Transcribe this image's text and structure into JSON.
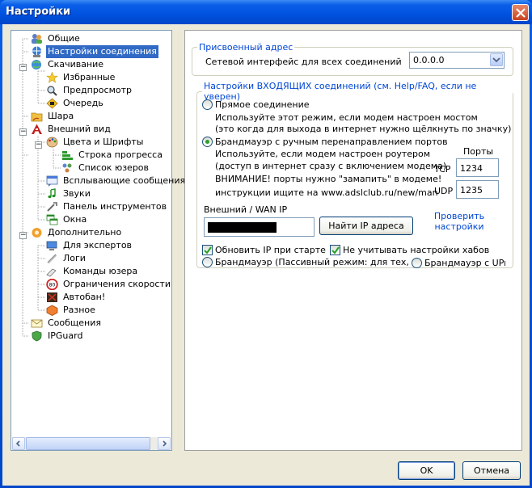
{
  "window": {
    "title": "Настройки"
  },
  "tree": {
    "items": [
      {
        "label": "Общие",
        "icon": "users-icon"
      },
      {
        "label": "Настройки соединения",
        "icon": "network-icon"
      },
      {
        "label": "Скачивание",
        "icon": "globe-download-icon"
      },
      {
        "label": "Избранные",
        "icon": "star-icon"
      },
      {
        "label": "Предпросмотр",
        "icon": "preview-icon"
      },
      {
        "label": "Очередь",
        "icon": "queue-icon"
      },
      {
        "label": "Шара",
        "icon": "share-folder-icon"
      },
      {
        "label": "Внешний вид",
        "icon": "appearance-icon"
      },
      {
        "label": "Цвета и Шрифты",
        "icon": "palette-icon"
      },
      {
        "label": "Строка прогресса",
        "icon": "progress-bar-icon"
      },
      {
        "label": "Список юзеров",
        "icon": "user-list-icon"
      },
      {
        "label": "Всплывающие сообщения",
        "icon": "popup-icon"
      },
      {
        "label": "Звуки",
        "icon": "music-note-icon"
      },
      {
        "label": "Панель инструментов",
        "icon": "toolbar-icon"
      },
      {
        "label": "Окна",
        "icon": "windows-icon"
      },
      {
        "label": "Дополнительно",
        "icon": "advanced-icon"
      },
      {
        "label": "Для экспертов",
        "icon": "expert-icon"
      },
      {
        "label": "Логи",
        "icon": "logs-icon"
      },
      {
        "label": "Команды юзера",
        "icon": "user-commands-icon"
      },
      {
        "label": "Ограничения скорости",
        "icon": "speed-limit-icon"
      },
      {
        "label": "Автобан!",
        "icon": "autoban-icon"
      },
      {
        "label": "Разное",
        "icon": "misc-icon"
      },
      {
        "label": "Сообщения",
        "icon": "messages-icon"
      },
      {
        "label": "IPGuard",
        "icon": "ipguard-icon"
      }
    ]
  },
  "assigned_address": {
    "legend": "Присвоенный адрес",
    "interface_label": "Сетевой интерфейс для всех соединений",
    "interface_value": "0.0.0.0"
  },
  "incoming": {
    "legend": "Настройки ВХОДЯЩИХ соединений (см. Help/FAQ, если не уверен)",
    "direct_label": "Прямое соединение",
    "direct_desc_1": "Используйте этот режим, если модем настроен мостом",
    "direct_desc_2": "(это когда для выхода в интернет нужно щёлкнуть по значку)",
    "firewall_manual_label": "Брандмауэр с ручным перенаправлением портов",
    "firewall_desc_1": "Используйте, если модем настроен роутером",
    "firewall_desc_2": "(доступ в интернет сразу с включением модема)",
    "firewall_desc_3": "ВНИМАНИЕ! порты нужно \"замапить\" в модеме!",
    "firewall_desc_4": "инструкции ищите на www.adslclub.ru/new/man",
    "ports_label": "Порты",
    "tcp_label": "TCP",
    "tcp_value": "1234",
    "udp_label": "UDP",
    "udp_value": "1235",
    "wan_label": "Внешний / WAN IP",
    "find_ip_button": "Найти IP адреса",
    "check_settings_link_1": "Проверить",
    "check_settings_link_2": "настройки",
    "update_ip_label": "Обновить IP при старте",
    "ignore_hub_label": "Не учитывать настройки хабов",
    "firewall_passive_label": "Брандмауэр (Пассивный режим: для тех,",
    "firewall_upnp_label": "Брандмауэр с UPnP ("
  },
  "buttons": {
    "ok": "OK",
    "cancel": "Отмена"
  },
  "colors": {
    "title_blue": "#0054e3",
    "selection": "#316ac5",
    "group_legend": "#0046d5"
  }
}
